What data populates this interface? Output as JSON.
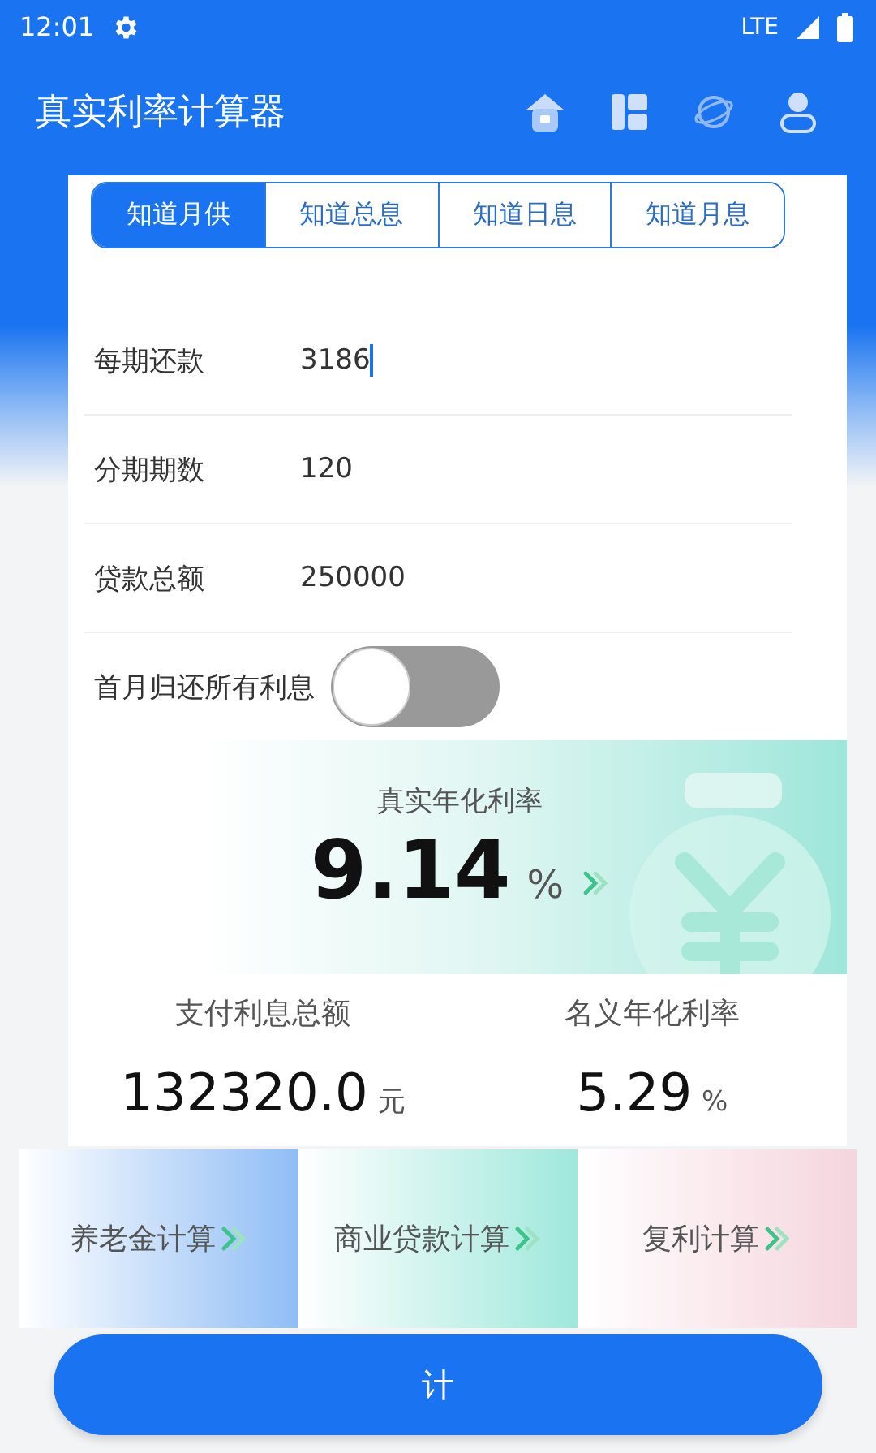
{
  "status_bar": {
    "time": "12:01",
    "network": "LTE"
  },
  "app_bar": {
    "title": "真实利率计算器"
  },
  "tabs": [
    {
      "label": "知道月供",
      "selected": true
    },
    {
      "label": "知道总息",
      "selected": false
    },
    {
      "label": "知道日息",
      "selected": false
    },
    {
      "label": "知道月息",
      "selected": false
    }
  ],
  "fields": [
    {
      "label": "每期还款",
      "value": "3186",
      "focused": true
    },
    {
      "label": "分期期数",
      "value": "120",
      "focused": false
    },
    {
      "label": "贷款总额",
      "value": "250000",
      "focused": false
    }
  ],
  "toggle": {
    "label": "首月归还所有利息",
    "on": false
  },
  "result": {
    "label": "真实年化利率",
    "value": "9.14",
    "unit": "%"
  },
  "stats": [
    {
      "label": "支付利息总额",
      "value": "132320.0",
      "unit": "元"
    },
    {
      "label": "名义年化利率",
      "value": "5.29",
      "unit": "%"
    }
  ],
  "shortcuts": [
    {
      "label": "养老金计算",
      "color": "#8fbdf5"
    },
    {
      "label": "商业贷款计算",
      "color": "#9fe8dc"
    },
    {
      "label": "复利计算",
      "color": "#f5d5de"
    }
  ],
  "calculate_button": {
    "label": "计"
  }
}
